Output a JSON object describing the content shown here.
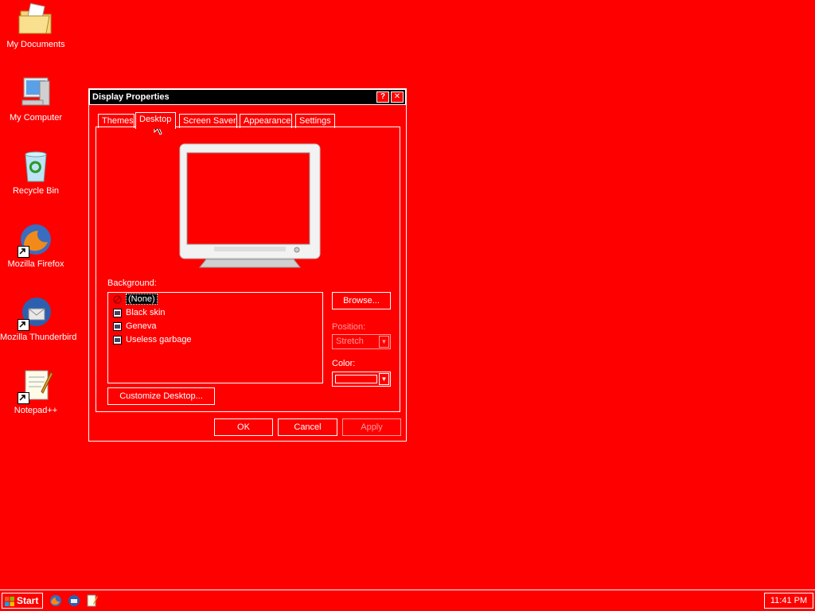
{
  "desktop": {
    "icons": [
      {
        "label": "My Documents",
        "icon": "folder-documents-icon"
      },
      {
        "label": "My Computer",
        "icon": "computer-icon"
      },
      {
        "label": "Recycle Bin",
        "icon": "recycle-bin-icon"
      },
      {
        "label": "Mozilla Firefox",
        "icon": "firefox-icon"
      },
      {
        "label": "Mozilla Thunderbird",
        "icon": "thunderbird-icon"
      },
      {
        "label": "Notepad++",
        "icon": "notepad-plus-plus-icon"
      }
    ],
    "background_color": "#ff0000"
  },
  "dialog": {
    "title": "Display Properties",
    "help_button": "?",
    "close_button": "✕",
    "tabs": [
      {
        "label": "Themes",
        "active": false
      },
      {
        "label": "Desktop",
        "active": true
      },
      {
        "label": "Screen Saver",
        "active": false
      },
      {
        "label": "Appearance",
        "active": false
      },
      {
        "label": "Settings",
        "active": false
      }
    ],
    "background_label": "Background:",
    "background_list": [
      {
        "label": "(None)",
        "selected": true,
        "icon": "none-icon"
      },
      {
        "label": "Black skin",
        "selected": false,
        "icon": "image-file-icon"
      },
      {
        "label": "Geneva",
        "selected": false,
        "icon": "image-file-icon"
      },
      {
        "label": "Useless garbage",
        "selected": false,
        "icon": "image-file-icon"
      }
    ],
    "browse_button": "Browse...",
    "position_label": "Position:",
    "position_value": "Stretch",
    "color_label": "Color:",
    "color_value": "#ff0000",
    "customize_button": "Customize Desktop...",
    "ok_button": "OK",
    "cancel_button": "Cancel",
    "apply_button": "Apply"
  },
  "taskbar": {
    "start_label": "Start",
    "quick_launch": [
      "firefox-icon",
      "thunderbird-icon",
      "notepad-plus-plus-icon"
    ],
    "clock": "11:41 PM"
  }
}
